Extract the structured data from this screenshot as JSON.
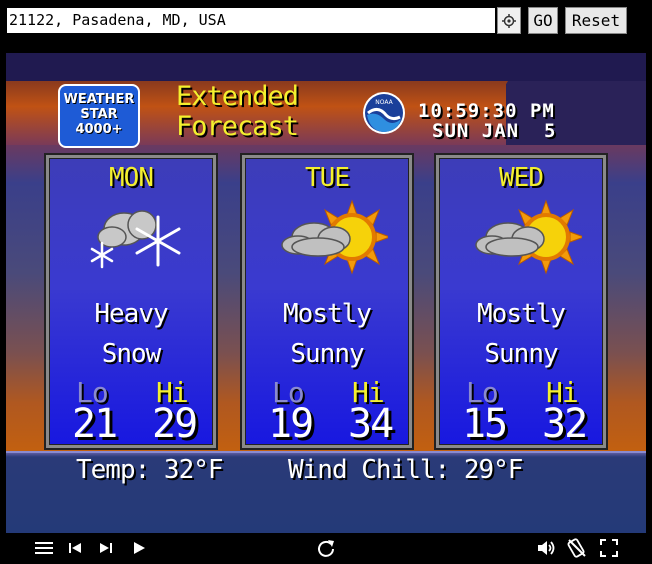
{
  "location": {
    "input_value": "21122, Pasadena, MD, USA",
    "go_label": "GO",
    "reset_label": "Reset",
    "gps_icon": "crosshair-icon"
  },
  "header": {
    "logo_line1": "WEATHER",
    "logo_line2": "STAR",
    "logo_line3": "4000+",
    "title_line1": "Extended",
    "title_line2": "Forecast",
    "noaa_logo_text": "NOAA",
    "time": "10:59:30 PM",
    "date": "SUN JAN  5"
  },
  "forecast": [
    {
      "day": "MON",
      "icon": "snow-icon",
      "cond_line1": "Heavy",
      "cond_line2": "Snow",
      "lo_label": "Lo",
      "hi_label": "Hi",
      "lo": "21",
      "hi": "29"
    },
    {
      "day": "TUE",
      "icon": "mostly-sunny-icon",
      "cond_line1": "Mostly",
      "cond_line2": "Sunny",
      "lo_label": "Lo",
      "hi_label": "Hi",
      "lo": "19",
      "hi": "34"
    },
    {
      "day": "WED",
      "icon": "mostly-sunny-icon",
      "cond_line1": "Mostly",
      "cond_line2": "Sunny",
      "lo_label": "Lo",
      "hi_label": "Hi",
      "lo": "15",
      "hi": "32"
    }
  ],
  "current": {
    "temp": "Temp: 32°F",
    "wind_chill": "Wind Chill: 29°F"
  },
  "controls": [
    "menu-icon",
    "previous-icon",
    "next-icon",
    "play-icon",
    "refresh-icon",
    "volume-icon",
    "no-kiosk-icon",
    "fullscreen-icon"
  ],
  "colors": {
    "title_yellow": "#f4f02e",
    "panel_blue": "#1818e0",
    "logo_blue": "#1e5bd6"
  }
}
